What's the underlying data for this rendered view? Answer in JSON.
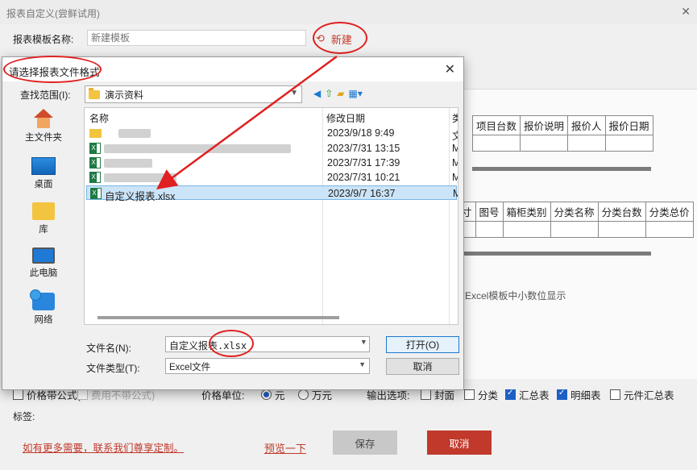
{
  "main": {
    "title": "报表自定义(尝鲜试用)",
    "close": "✕",
    "template_label": "报表模板名称:",
    "template_placeholder": "新建模板",
    "new_label": "新建",
    "new_icon": "refresh-icon",
    "table1_headers": [
      "项目台数",
      "报价说明",
      "报价人",
      "报价日期"
    ],
    "table2_headers": [
      "寸",
      "图号",
      "箱柜类别",
      "分类名称",
      "分类台数",
      "分类总价"
    ],
    "excel_note": "在Excel模板中小数位显示",
    "options": {
      "price_formula_label": "价格带公式(",
      "fee_formula_label": "费用不带公式)",
      "price_unit_label": "价格单位:",
      "unit_yuan": "元",
      "unit_wanyuan": "万元",
      "output_label": "输出选项:",
      "cover": "封面",
      "category": "分类",
      "summary": "汇总表",
      "detail": "明细表",
      "parts_summary": "元件汇总表"
    },
    "tag_label": "标签:",
    "more_link": "如有更多需要，联系我们尊享定制。",
    "preview": "预览一下",
    "save": "保存",
    "cancel": "取消"
  },
  "dialog": {
    "title": "请选择报表文件格式",
    "close": "✕",
    "look_in_label": "查找范围(I):",
    "look_in_value": "演示资料",
    "sidebar": [
      {
        "label": "主文件夹",
        "icon": "home-icon"
      },
      {
        "label": "桌面",
        "icon": "desktop-icon"
      },
      {
        "label": "库",
        "icon": "library-icon"
      },
      {
        "label": "此电脑",
        "icon": "computer-icon"
      },
      {
        "label": "网络",
        "icon": "network-icon"
      }
    ],
    "columns": {
      "name": "名称",
      "modified": "修改日期",
      "type": "类"
    },
    "files": [
      {
        "name": "",
        "date": "2023/9/18 9:49",
        "type": "文"
      },
      {
        "name": "",
        "date": "2023/7/31 13:15",
        "type": "M"
      },
      {
        "name": "",
        "date": "2023/7/31 17:39",
        "type": "M"
      },
      {
        "name": "",
        "date": "2023/7/31 10:21",
        "type": "M"
      },
      {
        "name": "自定义报表.xlsx",
        "date": "2023/9/7 16:37",
        "type": "M"
      }
    ],
    "filename_label": "文件名(N):",
    "filename_value": "自定义报表.xlsx",
    "filetype_label": "文件类型(T):",
    "filetype_value": "Excel文件",
    "open_label": "打开(O)",
    "cancel_label": "取消"
  },
  "colors": {
    "accent_red": "#c0392b",
    "annotation_red": "#e02020",
    "selection_blue": "#cce4f7"
  }
}
